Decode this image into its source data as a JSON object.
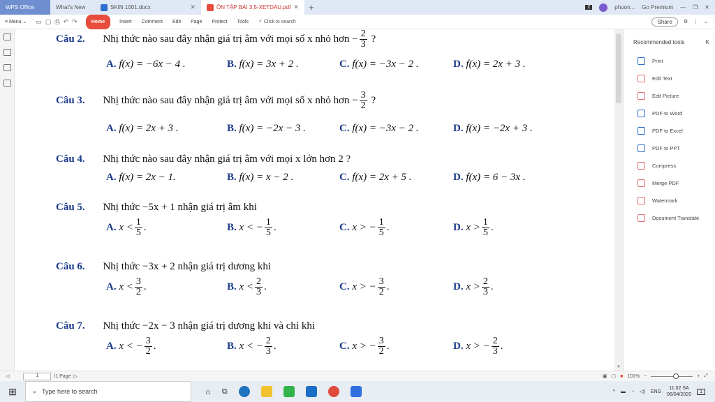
{
  "tabs": [
    {
      "label": "WPS Office"
    },
    {
      "label": "What's New"
    },
    {
      "label": "SKIN 1001.docx"
    },
    {
      "label": "ÔN TẬP BÀI 3,5-XETDAU.pdf"
    }
  ],
  "window": {
    "badge": "2",
    "user": "phuon...",
    "premium": "Go Premium"
  },
  "menu": {
    "menu": "Menu",
    "items": [
      "Home",
      "Insert",
      "Comment",
      "Edit",
      "Page",
      "Protect",
      "Tools"
    ],
    "search": "Click to search",
    "share": "Share"
  },
  "panel": {
    "title": "Recommended tools",
    "close": "K",
    "tools": [
      "Print",
      "Edit Text",
      "Edit Picture",
      "PDF to Word",
      "PDF to Excel",
      "PDF to PPT",
      "Compress",
      "Merge PDF",
      "Watermark",
      "Document Translate"
    ]
  },
  "doc": {
    "q2": {
      "num": "Câu 2.",
      "text": "Nhị thức nào sau đây nhận giá trị âm với mọi số x nhỏ hơn −",
      "fn": "2",
      "fd": "3",
      "tail": "?",
      "opts": [
        "f(x) = −6x − 4 .",
        "f(x) = 3x + 2 .",
        "f(x) = −3x − 2 .",
        "f(x) = 2x + 3 ."
      ]
    },
    "q3": {
      "num": "Câu 3.",
      "text": "Nhị thức nào sau đây nhận giá trị âm với mọi số x nhỏ hơn −",
      "fn": "3",
      "fd": "2",
      "tail": "?",
      "opts": [
        "f(x) = 2x + 3 .",
        "f(x) = −2x − 3 .",
        "f(x) = −3x − 2 .",
        "f(x) = −2x + 3 ."
      ]
    },
    "q4": {
      "num": "Câu 4.",
      "text": "Nhị thức nào sau đây nhận giá trị âm với mọi x lớn hơn 2 ?",
      "opts": [
        "f(x) = 2x − 1.",
        "f(x) = x − 2 .",
        "f(x) = 2x + 5 .",
        "f(x) = 6 − 3x ."
      ]
    },
    "q5": {
      "num": "Câu 5.",
      "text": "Nhị thức −5x + 1 nhận giá trị âm khi",
      "opts": [
        {
          "pre": "x <",
          "fn": "1",
          "fd": "5"
        },
        {
          "pre": "x < −",
          "fn": "1",
          "fd": "5"
        },
        {
          "pre": "x > −",
          "fn": "1",
          "fd": "5"
        },
        {
          "pre": "x >",
          "fn": "1",
          "fd": "5"
        }
      ]
    },
    "q6": {
      "num": "Câu 6.",
      "text": "Nhị thức −3x + 2 nhận giá trị dương khi",
      "opts": [
        {
          "pre": "x <",
          "fn": "3",
          "fd": "2"
        },
        {
          "pre": "x <",
          "fn": "2",
          "fd": "3"
        },
        {
          "pre": "x > −",
          "fn": "3",
          "fd": "2"
        },
        {
          "pre": "x >",
          "fn": "2",
          "fd": "3"
        }
      ]
    },
    "q7": {
      "num": "Câu 7.",
      "text": "Nhị thức −2x − 3 nhận giá trị dương khi và chỉ khi",
      "opts": [
        {
          "pre": "x < −",
          "fn": "3",
          "fd": "2"
        },
        {
          "pre": "x < −",
          "fn": "2",
          "fd": "3"
        },
        {
          "pre": "x > −",
          "fn": "3",
          "fd": "2"
        },
        {
          "pre": "x > −",
          "fn": "2",
          "fd": "3"
        }
      ]
    },
    "letters": [
      "A.",
      "B.",
      "C.",
      "D."
    ]
  },
  "status": {
    "page": "1",
    "page_total": "/1 Page",
    "zoom": "101%"
  },
  "taskbar": {
    "search": "Type here to search",
    "lang": "ENG",
    "time": "11:02 SA",
    "date": "06/04/2020",
    "notif": "1"
  }
}
